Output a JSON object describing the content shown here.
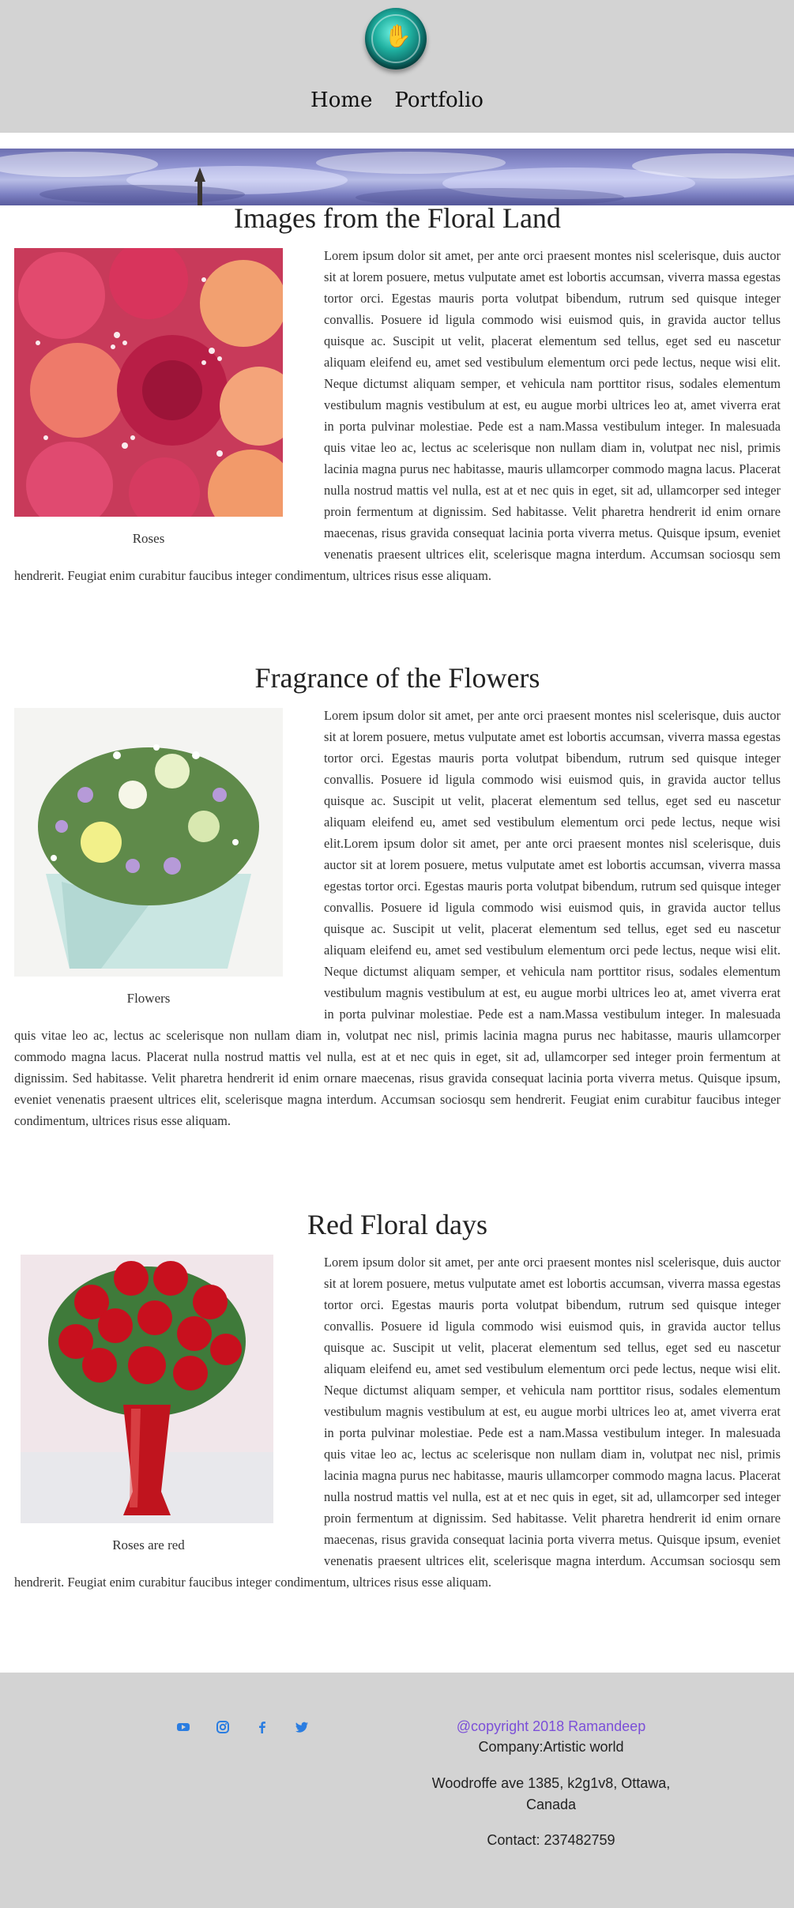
{
  "nav": {
    "home": "Home",
    "portfolio": "Portfolio"
  },
  "sections": [
    {
      "title": "Images from the Floral Land",
      "caption": "Roses",
      "text": "Lorem ipsum dolor sit amet, per ante orci praesent montes nisl scelerisque, duis auctor sit at lorem posuere, metus vulputate amet est lobortis accumsan, viverra massa egestas tortor orci. Egestas mauris porta volutpat bibendum, rutrum sed quisque integer convallis. Posuere id ligula commodo wisi euismod quis, in gravida auctor tellus quisque ac. Suscipit ut velit, placerat elementum sed tellus, eget sed eu nascetur aliquam eleifend eu, amet sed vestibulum elementum orci pede lectus, neque wisi elit. Neque dictumst aliquam semper, et vehicula nam porttitor risus, sodales elementum vestibulum magnis vestibulum at est, eu augue morbi ultrices leo at, amet viverra erat in porta pulvinar molestiae. Pede est a nam.Massa vestibulum integer. In malesuada quis vitae leo ac, lectus ac scelerisque non nullam diam in, volutpat nec nisl, primis lacinia magna purus nec habitasse, mauris ullamcorper commodo magna lacus. Placerat nulla nostrud mattis vel nulla, est at et nec quis in eget, sit ad, ullamcorper sed integer proin fermentum at dignissim. Sed habitasse. Velit pharetra hendrerit id enim ornare maecenas, risus gravida consequat lacinia porta viverra metus. Quisque ipsum, eveniet venenatis praesent ultrices elit, scelerisque magna interdum. Accumsan sociosqu sem hendrerit. Feugiat enim curabitur faucibus integer condimentum, ultrices risus esse aliquam."
    },
    {
      "title": "Fragrance of the Flowers",
      "caption": "Flowers",
      "text": "Lorem ipsum dolor sit amet, per ante orci praesent montes nisl scelerisque, duis auctor sit at lorem posuere, metus vulputate amet est lobortis accumsan, viverra massa egestas tortor orci. Egestas mauris porta volutpat bibendum, rutrum sed quisque integer convallis. Posuere id ligula commodo wisi euismod quis, in gravida auctor tellus quisque ac. Suscipit ut velit, placerat elementum sed tellus, eget sed eu nascetur aliquam eleifend eu, amet sed vestibulum elementum orci pede lectus, neque wisi elit.Lorem ipsum dolor sit amet, per ante orci praesent montes nisl scelerisque, duis auctor sit at lorem posuere, metus vulputate amet est lobortis accumsan, viverra massa egestas tortor orci. Egestas mauris porta volutpat bibendum, rutrum sed quisque integer convallis. Posuere id ligula commodo wisi euismod quis, in gravida auctor tellus quisque ac. Suscipit ut velit, placerat elementum sed tellus, eget sed eu nascetur aliquam eleifend eu, amet sed vestibulum elementum orci pede lectus, neque wisi elit. Neque dictumst aliquam semper, et vehicula nam porttitor risus, sodales elementum vestibulum magnis vestibulum at est, eu augue morbi ultrices leo at, amet viverra erat in porta pulvinar molestiae. Pede est a nam.Massa vestibulum integer. In malesuada quis vitae leo ac, lectus ac scelerisque non nullam diam in, volutpat nec nisl, primis lacinia magna purus nec habitasse, mauris ullamcorper commodo magna lacus. Placerat nulla nostrud mattis vel nulla, est at et nec quis in eget, sit ad, ullamcorper sed integer proin fermentum at dignissim. Sed habitasse. Velit pharetra hendrerit id enim ornare maecenas, risus gravida consequat lacinia porta viverra metus. Quisque ipsum, eveniet venenatis praesent ultrices elit, scelerisque magna interdum. Accumsan sociosqu sem hendrerit. Feugiat enim curabitur faucibus integer condimentum, ultrices risus esse aliquam."
    },
    {
      "title": "Red Floral days",
      "caption": "Roses are red",
      "text": "Lorem ipsum dolor sit amet, per ante orci praesent montes nisl scelerisque, duis auctor sit at lorem posuere, metus vulputate amet est lobortis accumsan, viverra massa egestas tortor orci. Egestas mauris porta volutpat bibendum, rutrum sed quisque integer convallis. Posuere id ligula commodo wisi euismod quis, in gravida auctor tellus quisque ac. Suscipit ut velit, placerat elementum sed tellus, eget sed eu nascetur aliquam eleifend eu, amet sed vestibulum elementum orci pede lectus, neque wisi elit. Neque dictumst aliquam semper, et vehicula nam porttitor risus, sodales elementum vestibulum magnis vestibulum at est, eu augue morbi ultrices leo at, amet viverra erat in porta pulvinar molestiae. Pede est a nam.Massa vestibulum integer. In malesuada quis vitae leo ac, lectus ac scelerisque non nullam diam in, volutpat nec nisl, primis lacinia magna purus nec habitasse, mauris ullamcorper commodo magna lacus. Placerat nulla nostrud mattis vel nulla, est at et nec quis in eget, sit ad, ullamcorper sed integer proin fermentum at dignissim. Sed habitasse. Velit pharetra hendrerit id enim ornare maecenas, risus gravida consequat lacinia porta viverra metus. Quisque ipsum, eveniet venenatis praesent ultrices elit, scelerisque magna interdum. Accumsan sociosqu sem hendrerit. Feugiat enim curabitur faucibus integer condimentum, ultrices risus esse aliquam."
    }
  ],
  "footer": {
    "social_icons": [
      "youtube-icon",
      "instagram-icon",
      "facebook-icon",
      "twitter-icon"
    ],
    "copyright": "@copyright 2018 Ramandeep",
    "company": "Company:Artistic world",
    "address_line1": "Woodroffe ave 1385, k2g1v8, Ottawa,",
    "address_line2": "Canada",
    "contact": "Contact: 237482759"
  },
  "colors": {
    "header_bg": "#d3d3d3",
    "footer_bg": "#d3d3d3",
    "social_icon": "#2a7de1",
    "copyright_text": "#7b4fd8"
  }
}
